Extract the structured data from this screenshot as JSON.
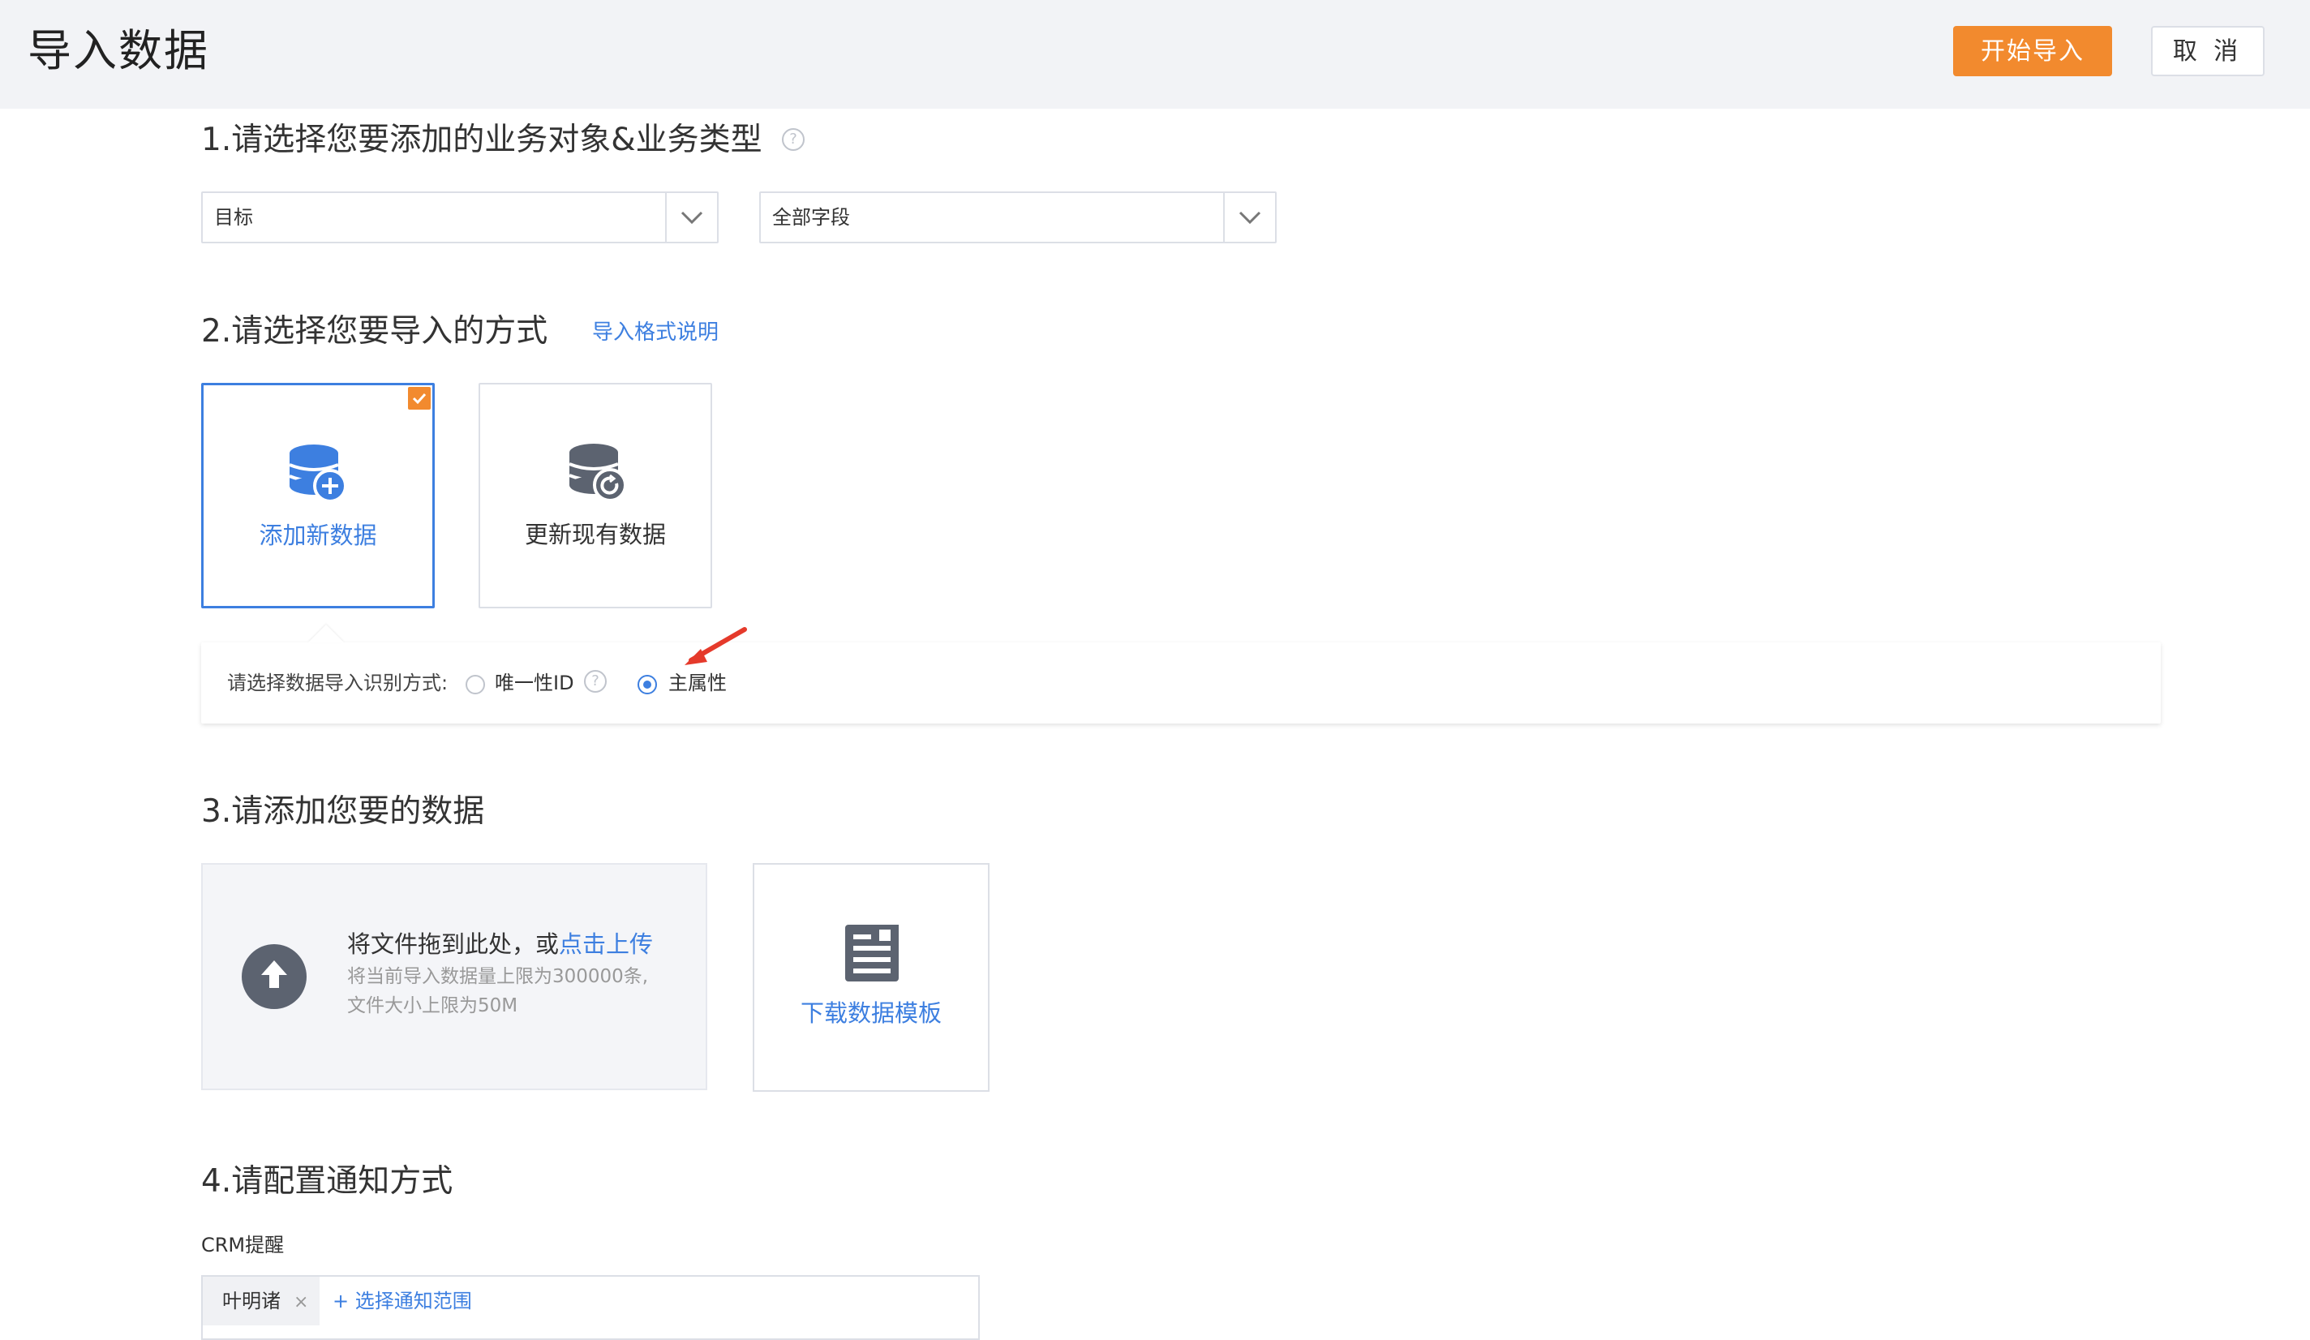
{
  "header": {
    "title": "导入数据",
    "start_button": "开始导入",
    "cancel_button": "取 消"
  },
  "step1": {
    "title": "1.请选择您要添加的业务对象&业务类型",
    "object_select": "目标",
    "type_select": "全部字段"
  },
  "step2": {
    "title": "2.请选择您要导入的方式",
    "format_link": "导入格式说明",
    "options": [
      {
        "label": "添加新数据",
        "icon": "database-add-icon",
        "selected": true
      },
      {
        "label": "更新现有数据",
        "icon": "database-refresh-icon",
        "selected": false
      }
    ],
    "identify": {
      "label": "请选择数据导入识别方式:",
      "option_unique_id": "唯一性ID",
      "option_main_attr": "主属性",
      "selected": "主属性"
    }
  },
  "step3": {
    "title": "3.请添加您要的数据",
    "upload_prefix": "将文件拖到此处，或",
    "upload_link": "点击上传",
    "upload_note_line1": "将当前导入数据量上限为300000条,",
    "upload_note_line2": "文件大小上限为50M",
    "template_label": "下载数据模板"
  },
  "step4": {
    "title": "4.请配置通知方式",
    "crm_label": "CRM提醒",
    "recipient": "叶明诸",
    "add_scope": "+ 选择通知范围"
  },
  "colors": {
    "primary": "#f28a2e",
    "accent": "#3d7fe0",
    "header_bg": "#f2f3f6",
    "annotation_arrow": "#e53a2b"
  }
}
